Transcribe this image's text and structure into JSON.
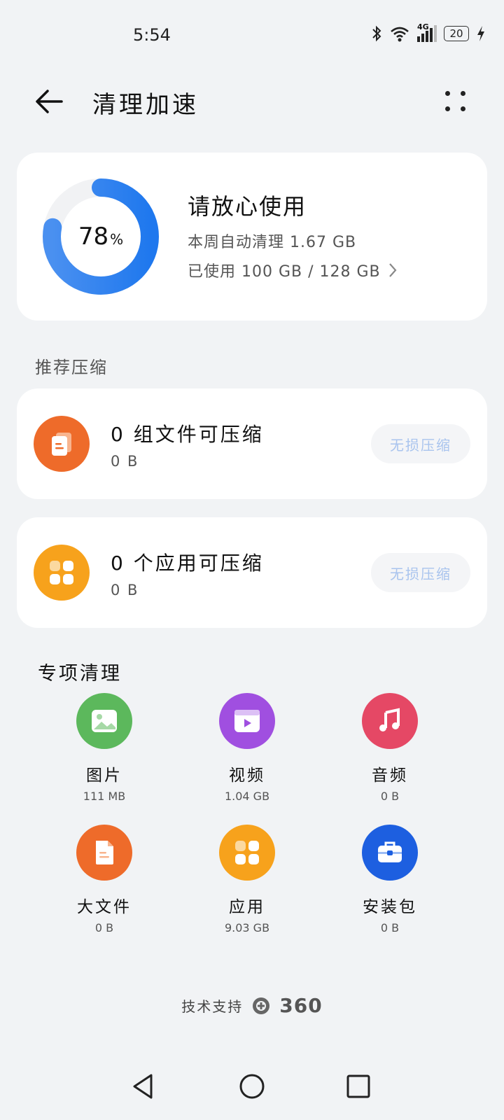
{
  "status_bar": {
    "time": "5:54",
    "network": "4G",
    "battery": "20"
  },
  "header": {
    "title": "清理加速"
  },
  "storage": {
    "percent": "78",
    "percent_unit": "%",
    "percent_value": 78,
    "headline": "请放心使用",
    "auto_clean": "本周自动清理 1.67 GB",
    "used": "已使用 100 GB / 128 GB"
  },
  "recommend": {
    "label": "推荐压缩",
    "items": [
      {
        "title": "0 组文件可压缩",
        "size": "0 B",
        "button": "无损压缩",
        "icon": "document-stack-icon",
        "color": "#ee6b2a"
      },
      {
        "title": "0 个应用可压缩",
        "size": "0 B",
        "button": "无损压缩",
        "icon": "apps-grid-icon",
        "color": "#f7a21c"
      }
    ]
  },
  "special": {
    "title": "专项清理",
    "items": [
      {
        "label": "图片",
        "size": "111 MB",
        "icon": "image-icon",
        "color": "#5cb85c"
      },
      {
        "label": "视频",
        "size": "1.04 GB",
        "icon": "video-icon",
        "color": "#a04fe0"
      },
      {
        "label": "音频",
        "size": "0 B",
        "icon": "music-icon",
        "color": "#e54865"
      },
      {
        "label": "大文件",
        "size": "0 B",
        "icon": "file-icon",
        "color": "#ee6b2a"
      },
      {
        "label": "应用",
        "size": "9.03 GB",
        "icon": "apps-grid-icon",
        "color": "#f7a21c"
      },
      {
        "label": "安装包",
        "size": "0 B",
        "icon": "toolbox-icon",
        "color": "#1d5fe0"
      }
    ]
  },
  "footer": {
    "support": "技术支持",
    "brand": "360"
  },
  "colors": {
    "accent": "#2f84f0",
    "background": "#f1f3f5"
  }
}
